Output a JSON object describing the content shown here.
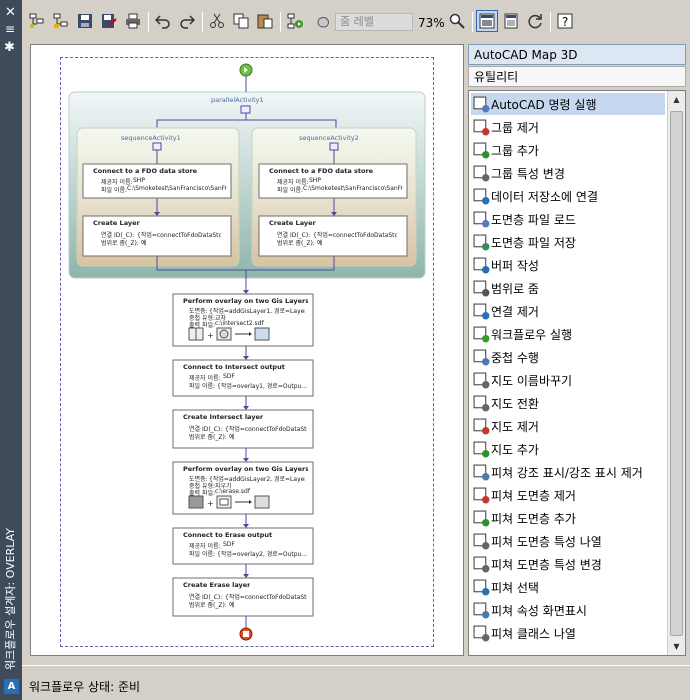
{
  "window": {
    "title": "워크플로우 설계자: OVERLAY",
    "logo": "A"
  },
  "toolbar": {
    "zoom_placeholder": "줌 레벨",
    "zoom_percent": "73%"
  },
  "workflow": {
    "parallel": "parallelActivity1",
    "seq1": "sequenceActivity1",
    "seq2": "sequenceActivity2",
    "connect_fdo": "Connect to a FDO data store",
    "provider_label": "제공자 이름:",
    "provider_shp": "SHP",
    "file_label": "파일 이름:",
    "file_path": "C:\\Smoketest\\SanFrancisco\\SanFr...",
    "create_layer": "Create Layer",
    "conn_label": "연결 ID(_C):",
    "conn_value": "{작업=connectToFdoDataSto...",
    "scope_label": "범위로 줌(_Z):",
    "scope_value": "예",
    "overlay1_title": "Perform overlay on two Gis Layers",
    "layer_label": "도면층:",
    "overlay1_layer": "{작업=addGisLayer1, 경로=Layer...",
    "overlay_type_label": "중첩 유형:",
    "overlay1_type": "교차",
    "output_label": "출력 파일:",
    "overlay1_output": "c:\\intersect2.sdf",
    "connect_intersect": "Connect to Intersect output",
    "provider_sdf": "SDF",
    "intersect_file": "{작업=overlay1, 경로=Outpu...",
    "create_intersect": "Create Intersect layer",
    "intersect_conn": "{작업=connectToFdoDataSto...",
    "scope_intersect": "예",
    "overlay2_title": "Perform overlay on two Gis Layers",
    "overlay2_layer": "{작업=addGisLayer2, 경로=Layer...",
    "overlay2_type": "지우기",
    "overlay2_output": "c:\\erase.sdf",
    "connect_erase": "Connect to Erase output",
    "erase_file": "{작업=overlay2, 경로=Outpu...",
    "create_erase": "Create Erase layer",
    "erase_conn": "{작업=connectToFdoDataSto...",
    "scope_erase": "예"
  },
  "panel": {
    "title": "AutoCAD Map 3D",
    "subtitle": "유틸리티",
    "items": [
      {
        "label": "AutoCAD 명령 실행",
        "icon": "command-run-icon"
      },
      {
        "label": "그룹 제거",
        "icon": "group-remove-icon"
      },
      {
        "label": "그룹 추가",
        "icon": "group-add-icon"
      },
      {
        "label": "그룹 특성 변경",
        "icon": "group-properties-icon"
      },
      {
        "label": "데이터 저장소에 연결",
        "icon": "data-store-connect-icon"
      },
      {
        "label": "도면층 파일 로드",
        "icon": "layer-file-load-icon"
      },
      {
        "label": "도면층 파일 저장",
        "icon": "layer-file-save-icon"
      },
      {
        "label": "버퍼 작성",
        "icon": "buffer-create-icon"
      },
      {
        "label": "범위로 줌",
        "icon": "zoom-extent-icon"
      },
      {
        "label": "연결 제거",
        "icon": "connection-remove-icon"
      },
      {
        "label": "워크플로우 실행",
        "icon": "workflow-run-icon"
      },
      {
        "label": "중첩 수행",
        "icon": "overlay-icon"
      },
      {
        "label": "지도 이름바꾸기",
        "icon": "map-rename-icon"
      },
      {
        "label": "지도 전환",
        "icon": "map-switch-icon"
      },
      {
        "label": "지도 제거",
        "icon": "map-remove-icon"
      },
      {
        "label": "지도 추가",
        "icon": "map-add-icon"
      },
      {
        "label": "피쳐 강조 표시/강조 표시 제거",
        "icon": "feature-highlight-icon"
      },
      {
        "label": "피쳐 도면층 제거",
        "icon": "feature-layer-remove-icon"
      },
      {
        "label": "피쳐 도면층 추가",
        "icon": "feature-layer-add-icon"
      },
      {
        "label": "피쳐 도면층 특성 나열",
        "icon": "feature-layer-props-list-icon"
      },
      {
        "label": "피쳐 도면층 특성 변경",
        "icon": "feature-layer-props-change-icon"
      },
      {
        "label": "피쳐 선택",
        "icon": "feature-select-icon"
      },
      {
        "label": "피쳐 속성 화면표시",
        "icon": "feature-attribute-display-icon"
      },
      {
        "label": "피쳐 클래스 나열",
        "icon": "feature-class-list-icon"
      }
    ]
  },
  "status": {
    "text": "워크플로우 상태: 준비"
  }
}
